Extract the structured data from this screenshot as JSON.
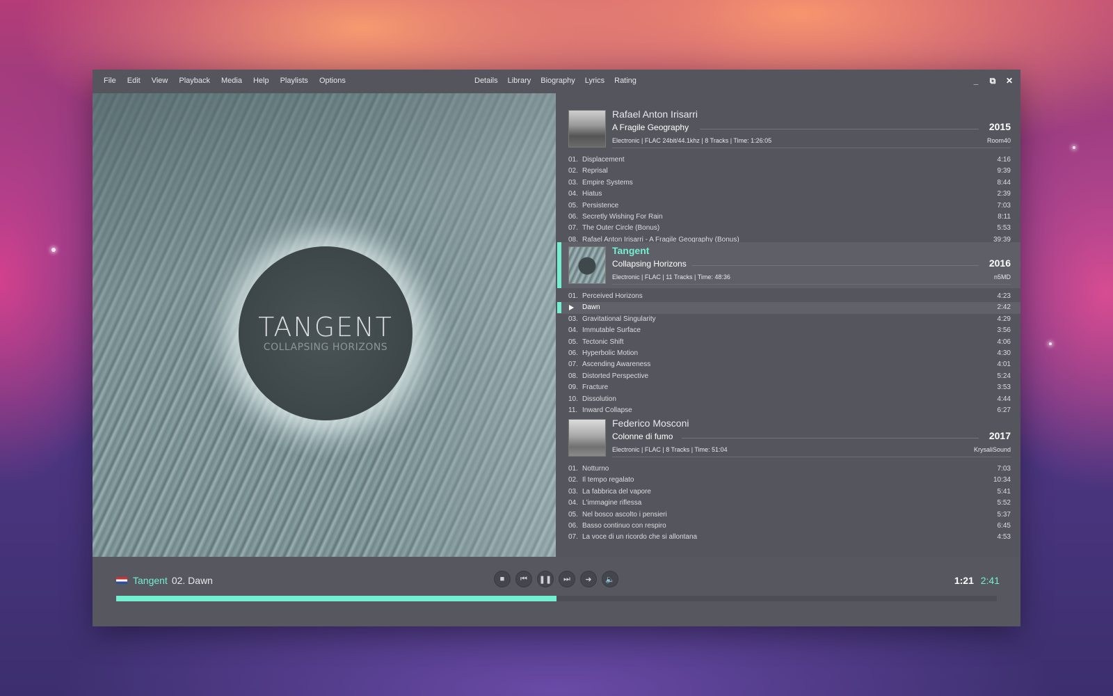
{
  "menu": {
    "left": [
      "File",
      "Edit",
      "View",
      "Playback",
      "Media",
      "Help",
      "Playlists",
      "Options"
    ],
    "center": [
      "Details",
      "Library",
      "Biography",
      "Lyrics",
      "Rating"
    ]
  },
  "window_controls": {
    "minimize": "_",
    "maximize": "⧉",
    "close": "✕"
  },
  "art": {
    "title": "TANGENT",
    "subtitle": "COLLAPSING HORIZONS"
  },
  "albums": [
    {
      "artist": "Rafael Anton Irisarri",
      "album": "A Fragile Geography",
      "year": "2015",
      "meta": "Electronic | FLAC 24bit/44.1khz | 8 Tracks | Time: 1:26:05",
      "label": "Room40",
      "tracks": [
        {
          "num": "01.",
          "title": "Displacement",
          "dur": "4:16"
        },
        {
          "num": "02.",
          "title": "Reprisal",
          "dur": "9:39"
        },
        {
          "num": "03.",
          "title": "Empire Systems",
          "dur": "8:44"
        },
        {
          "num": "04.",
          "title": "Hiatus",
          "dur": "2:39"
        },
        {
          "num": "05.",
          "title": "Persistence",
          "dur": "7:03"
        },
        {
          "num": "06.",
          "title": "Secretly Wishing For Rain",
          "dur": "8:11"
        },
        {
          "num": "07.",
          "title": "The Outer Circle (Bonus)",
          "dur": "5:53"
        },
        {
          "num": "08.",
          "title": "Rafael Anton Irisarri - A Fragile Geography (Bonus)",
          "dur": "39:39"
        }
      ]
    },
    {
      "artist": "Tangent",
      "album": "Collapsing Horizons",
      "year": "2016",
      "meta": "Electronic | FLAC | 11 Tracks | Time: 48:36",
      "label": "n5MD",
      "tracks": [
        {
          "num": "01.",
          "title": "Perceived Horizons",
          "dur": "4:23"
        },
        {
          "num": "",
          "title": "Dawn",
          "dur": "2:42"
        },
        {
          "num": "03.",
          "title": "Gravitational Singularity",
          "dur": "4:29"
        },
        {
          "num": "04.",
          "title": "Immutable Surface",
          "dur": "3:56"
        },
        {
          "num": "05.",
          "title": "Tectonic Shift",
          "dur": "4:06"
        },
        {
          "num": "06.",
          "title": "Hyperbolic Motion",
          "dur": "4:30"
        },
        {
          "num": "07.",
          "title": "Ascending Awareness",
          "dur": "4:01"
        },
        {
          "num": "08.",
          "title": "Distorted Perspective",
          "dur": "5:24"
        },
        {
          "num": "09.",
          "title": "Fracture",
          "dur": "3:53"
        },
        {
          "num": "10.",
          "title": "Dissolution",
          "dur": "4:44"
        },
        {
          "num": "11.",
          "title": "Inward Collapse",
          "dur": "6:27"
        }
      ]
    },
    {
      "artist": "Federico Mosconi",
      "album": "Colonne di fumo",
      "year": "2017",
      "meta": "Electronic | FLAC | 8 Tracks | Time: 51:04",
      "label": "KrysaliSound",
      "tracks": [
        {
          "num": "01.",
          "title": "Notturno",
          "dur": "7:03"
        },
        {
          "num": "02.",
          "title": "Il tempo regalato",
          "dur": "10:34"
        },
        {
          "num": "03.",
          "title": "La fabbrica del vapore",
          "dur": "5:41"
        },
        {
          "num": "04.",
          "title": "L'immagine riflessa",
          "dur": "5:52"
        },
        {
          "num": "05.",
          "title": "Nel bosco ascolto i pensieri",
          "dur": "5:37"
        },
        {
          "num": "06.",
          "title": "Basso continuo con respiro",
          "dur": "6:45"
        },
        {
          "num": "07.",
          "title": "La voce di un ricordo che si allontana",
          "dur": "4:53"
        }
      ]
    }
  ],
  "now_playing": {
    "artist": "Tangent",
    "track": "02. Dawn",
    "time_current": "1:21",
    "time_total": "2:41",
    "progress": 0.5
  },
  "colors": {
    "accent": "#72f0d0",
    "window": "#55555d"
  }
}
